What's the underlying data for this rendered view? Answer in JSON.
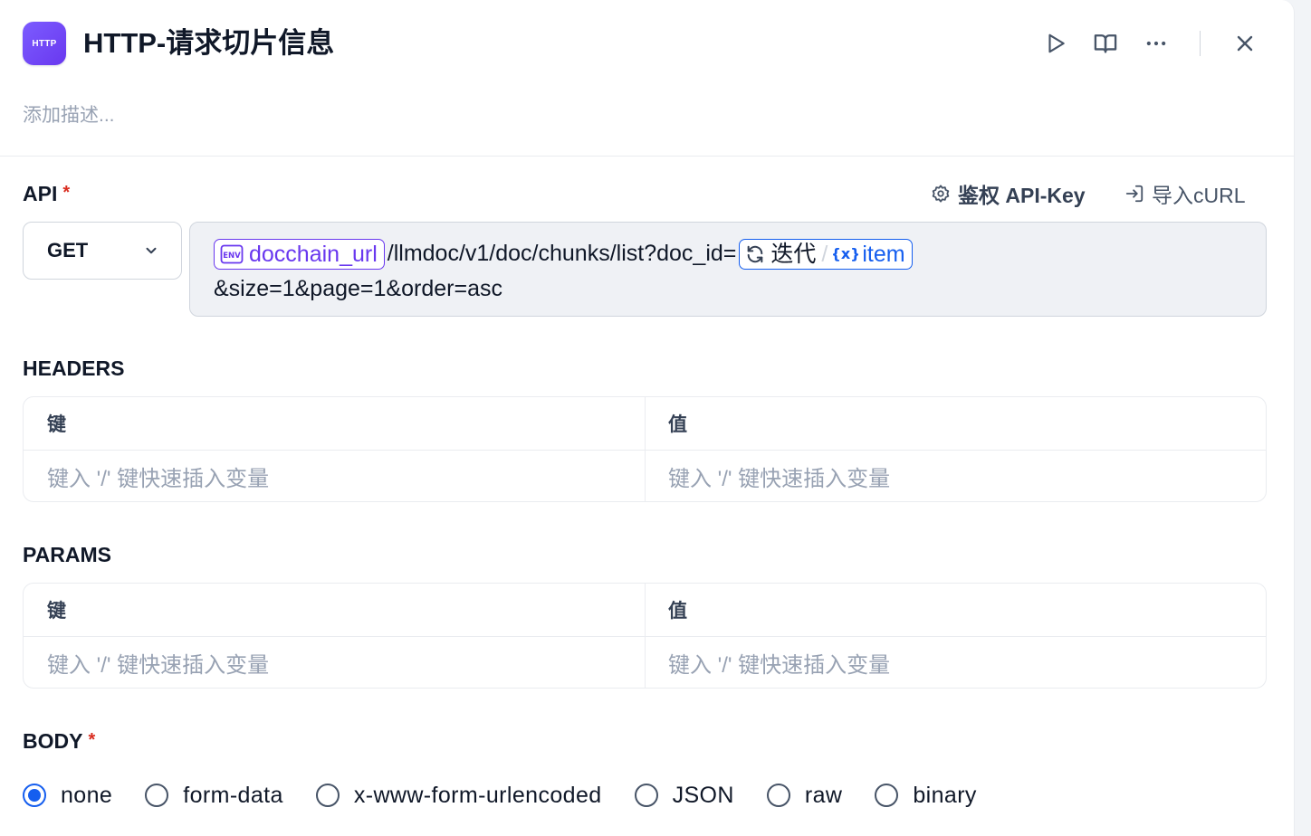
{
  "header": {
    "node_badge": "HTTP",
    "title": "HTTP-请求切片信息",
    "description_placeholder": "添加描述..."
  },
  "api": {
    "label": "API",
    "required_mark": "*",
    "auth_label": "鉴权 API-Key",
    "import_label": "导入cURL",
    "method": "GET",
    "url": {
      "env_var": "docchain_url",
      "path": "/llmdoc/v1/doc/chunks/list?doc_id=",
      "loop_node": "迭代",
      "loop_var": "item",
      "suffix": "&size=1&page=1&order=asc"
    }
  },
  "headers": {
    "label": "HEADERS",
    "key_header": "键",
    "value_header": "值",
    "key_placeholder": "键入 '/' 键快速插入变量",
    "value_placeholder": "键入 '/' 键快速插入变量"
  },
  "params": {
    "label": "PARAMS",
    "key_header": "键",
    "value_header": "值",
    "key_placeholder": "键入 '/' 键快速插入变量",
    "value_placeholder": "键入 '/' 键快速插入变量"
  },
  "body": {
    "label": "BODY",
    "required_mark": "*",
    "selected": "none",
    "options": [
      "none",
      "form-data",
      "x-www-form-urlencoded",
      "JSON",
      "raw",
      "binary"
    ]
  },
  "colors": {
    "accent": "#155eef",
    "env_var": "#6938ef",
    "required": "#d92d20",
    "placeholder": "#98a2b3"
  },
  "icons": [
    "play-icon",
    "book-icon",
    "more-icon",
    "close-icon",
    "gear-icon",
    "import-icon",
    "chevron-down-icon",
    "env-icon",
    "loop-icon",
    "variable-icon"
  ]
}
